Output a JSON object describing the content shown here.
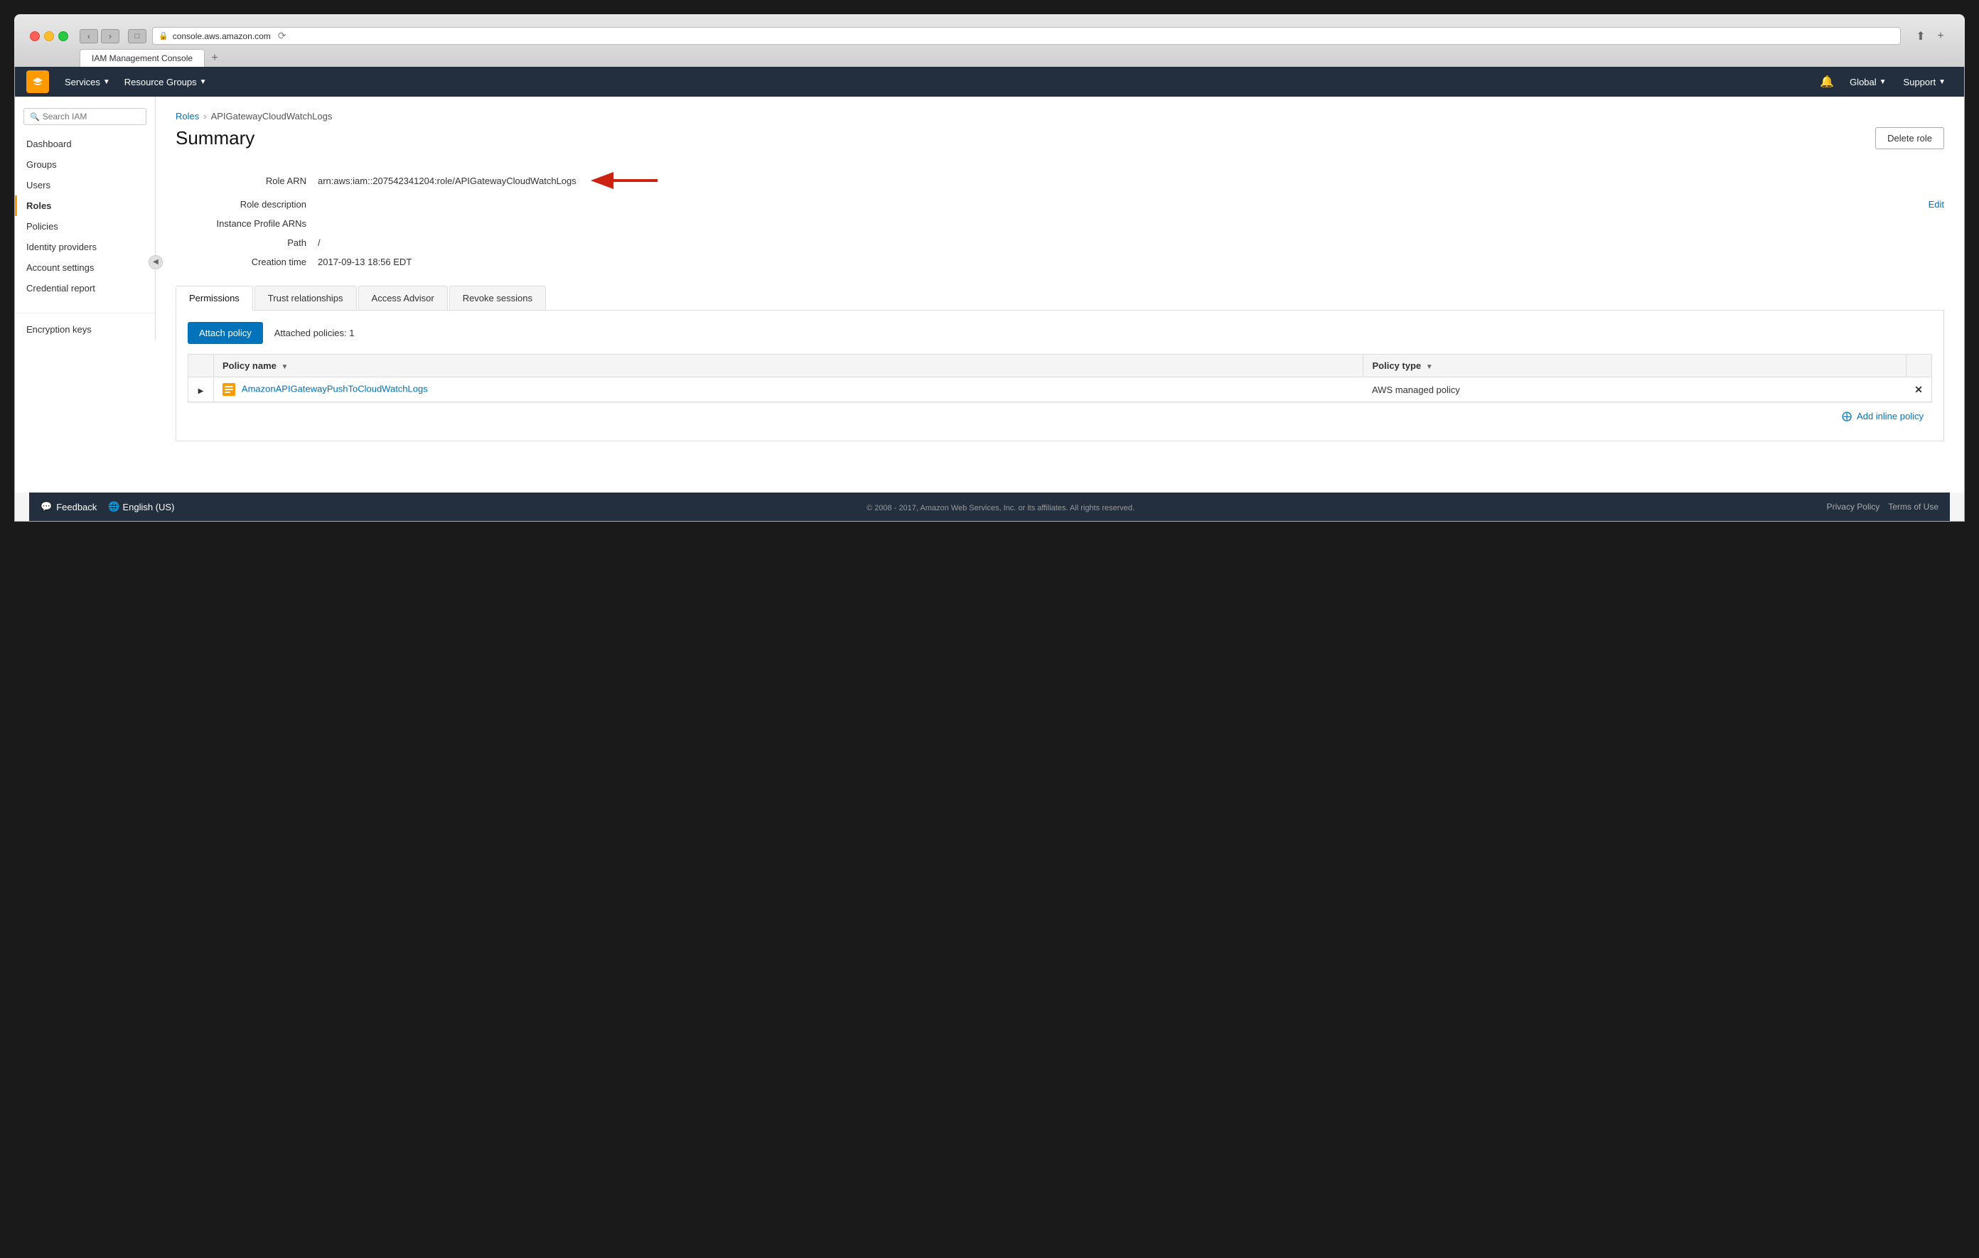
{
  "browser": {
    "url": "console.aws.amazon.com",
    "tab_label": "IAM Management Console"
  },
  "topnav": {
    "services_label": "Services",
    "resource_groups_label": "Resource Groups",
    "global_label": "Global",
    "support_label": "Support"
  },
  "sidebar": {
    "search_placeholder": "Search IAM",
    "items": [
      {
        "id": "dashboard",
        "label": "Dashboard"
      },
      {
        "id": "groups",
        "label": "Groups"
      },
      {
        "id": "users",
        "label": "Users"
      },
      {
        "id": "roles",
        "label": "Roles",
        "active": true
      },
      {
        "id": "policies",
        "label": "Policies"
      },
      {
        "id": "identity-providers",
        "label": "Identity providers"
      },
      {
        "id": "account-settings",
        "label": "Account settings"
      },
      {
        "id": "credential-report",
        "label": "Credential report"
      }
    ],
    "extra_items": [
      {
        "id": "encryption-keys",
        "label": "Encryption keys"
      }
    ]
  },
  "breadcrumb": {
    "parent_label": "Roles",
    "current_label": "APIGatewayCloudWatchLogs"
  },
  "page": {
    "title": "Summary",
    "delete_role_label": "Delete role"
  },
  "summary": {
    "fields": [
      {
        "label": "Role ARN",
        "value": "arn:aws:iam::207542341204:role/APIGatewayCloudWatchLogs",
        "has_arrow": true
      },
      {
        "label": "Role description",
        "value": "",
        "has_edit": true
      },
      {
        "label": "Instance Profile ARNs",
        "value": ""
      },
      {
        "label": "Path",
        "value": "/"
      },
      {
        "label": "Creation time",
        "value": "2017-09-13 18:56 EDT"
      }
    ]
  },
  "tabs": {
    "items": [
      {
        "id": "permissions",
        "label": "Permissions",
        "active": true
      },
      {
        "id": "trust-relationships",
        "label": "Trust relationships"
      },
      {
        "id": "access-advisor",
        "label": "Access Advisor"
      },
      {
        "id": "revoke-sessions",
        "label": "Revoke sessions"
      }
    ]
  },
  "permissions_tab": {
    "attach_policy_label": "Attach policy",
    "attached_count_label": "Attached policies: 1",
    "table": {
      "columns": [
        {
          "id": "expand",
          "label": ""
        },
        {
          "id": "policy-name",
          "label": "Policy name"
        },
        {
          "id": "policy-type",
          "label": "Policy type"
        },
        {
          "id": "remove",
          "label": ""
        }
      ],
      "rows": [
        {
          "policy_name": "AmazonAPIGatewayPushToCloudWatchLogs",
          "policy_type": "AWS managed policy"
        }
      ]
    },
    "add_inline_label": "Add inline policy"
  },
  "footer": {
    "feedback_label": "Feedback",
    "language_label": "English (US)",
    "copyright": "© 2008 - 2017, Amazon Web Services, Inc. or its affiliates. All rights reserved.",
    "privacy_policy": "Privacy Policy",
    "terms_of_use": "Terms of Use"
  }
}
